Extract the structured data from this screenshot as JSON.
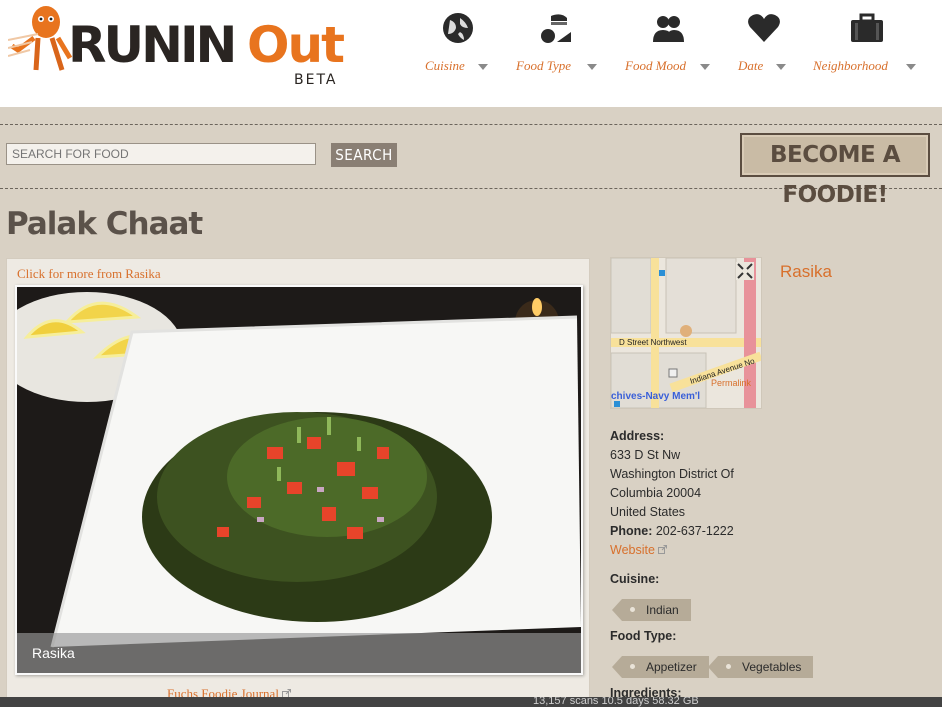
{
  "logo": {
    "part1": "RUNIN",
    "part2": "Out",
    "beta": "BETA"
  },
  "nav": [
    {
      "label": "Cuisine",
      "icon": "globe-icon"
    },
    {
      "label": "Food Type",
      "icon": "food-icon"
    },
    {
      "label": "Food Mood",
      "icon": "people-icon"
    },
    {
      "label": "Date",
      "icon": "heart-icon"
    },
    {
      "label": "Neighborhood",
      "icon": "briefcase-icon"
    }
  ],
  "search": {
    "placeholder": "SEARCH FOR FOOD",
    "button": "SEARCH"
  },
  "foodie_button": "BECOME A FOODIE!",
  "page_title": "Palak Chaat",
  "card": {
    "more_link": "Click for more from Rasika",
    "photo_caption": "Rasika",
    "credit_link": "Fuchs Foodie Journal"
  },
  "map": {
    "street1": "D Street Northwest",
    "street2": "Indiana Avenue No",
    "permalink": "Permalink",
    "place": "chives-Navy Mem'l"
  },
  "restaurant": {
    "name": "Rasika",
    "address_label": "Address:",
    "address_lines": [
      "633 D St Nw",
      "Washington  District Of",
      "Columbia  20004",
      "United States"
    ],
    "phone_label": "Phone:",
    "phone": "202-637-1222",
    "website": "Website",
    "cuisine_label": "Cuisine:",
    "cuisine_tags": [
      "Indian"
    ],
    "food_type_label": "Food Type:",
    "food_type_tags": [
      "Appetizer",
      "Vegetables"
    ],
    "ingredients_label": "Ingredients:"
  },
  "taskbar": {
    "status": "13,157 scans  10.5 days  58.32 GB"
  },
  "colors": {
    "accent": "#d8702c",
    "background": "#d9d1c4",
    "tag": "#b6ab98"
  }
}
